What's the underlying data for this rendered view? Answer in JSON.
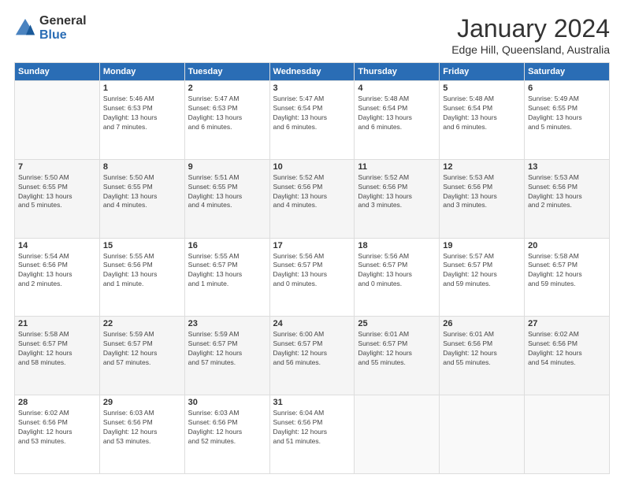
{
  "header": {
    "logo_general": "General",
    "logo_blue": "Blue",
    "month_title": "January 2024",
    "location": "Edge Hill, Queensland, Australia"
  },
  "weekdays": [
    "Sunday",
    "Monday",
    "Tuesday",
    "Wednesday",
    "Thursday",
    "Friday",
    "Saturday"
  ],
  "weeks": [
    [
      {
        "day": "",
        "info": ""
      },
      {
        "day": "1",
        "info": "Sunrise: 5:46 AM\nSunset: 6:53 PM\nDaylight: 13 hours\nand 7 minutes."
      },
      {
        "day": "2",
        "info": "Sunrise: 5:47 AM\nSunset: 6:53 PM\nDaylight: 13 hours\nand 6 minutes."
      },
      {
        "day": "3",
        "info": "Sunrise: 5:47 AM\nSunset: 6:54 PM\nDaylight: 13 hours\nand 6 minutes."
      },
      {
        "day": "4",
        "info": "Sunrise: 5:48 AM\nSunset: 6:54 PM\nDaylight: 13 hours\nand 6 minutes."
      },
      {
        "day": "5",
        "info": "Sunrise: 5:48 AM\nSunset: 6:54 PM\nDaylight: 13 hours\nand 6 minutes."
      },
      {
        "day": "6",
        "info": "Sunrise: 5:49 AM\nSunset: 6:55 PM\nDaylight: 13 hours\nand 5 minutes."
      }
    ],
    [
      {
        "day": "7",
        "info": "Sunrise: 5:50 AM\nSunset: 6:55 PM\nDaylight: 13 hours\nand 5 minutes."
      },
      {
        "day": "8",
        "info": "Sunrise: 5:50 AM\nSunset: 6:55 PM\nDaylight: 13 hours\nand 4 minutes."
      },
      {
        "day": "9",
        "info": "Sunrise: 5:51 AM\nSunset: 6:55 PM\nDaylight: 13 hours\nand 4 minutes."
      },
      {
        "day": "10",
        "info": "Sunrise: 5:52 AM\nSunset: 6:56 PM\nDaylight: 13 hours\nand 4 minutes."
      },
      {
        "day": "11",
        "info": "Sunrise: 5:52 AM\nSunset: 6:56 PM\nDaylight: 13 hours\nand 3 minutes."
      },
      {
        "day": "12",
        "info": "Sunrise: 5:53 AM\nSunset: 6:56 PM\nDaylight: 13 hours\nand 3 minutes."
      },
      {
        "day": "13",
        "info": "Sunrise: 5:53 AM\nSunset: 6:56 PM\nDaylight: 13 hours\nand 2 minutes."
      }
    ],
    [
      {
        "day": "14",
        "info": "Sunrise: 5:54 AM\nSunset: 6:56 PM\nDaylight: 13 hours\nand 2 minutes."
      },
      {
        "day": "15",
        "info": "Sunrise: 5:55 AM\nSunset: 6:56 PM\nDaylight: 13 hours\nand 1 minute."
      },
      {
        "day": "16",
        "info": "Sunrise: 5:55 AM\nSunset: 6:57 PM\nDaylight: 13 hours\nand 1 minute."
      },
      {
        "day": "17",
        "info": "Sunrise: 5:56 AM\nSunset: 6:57 PM\nDaylight: 13 hours\nand 0 minutes."
      },
      {
        "day": "18",
        "info": "Sunrise: 5:56 AM\nSunset: 6:57 PM\nDaylight: 13 hours\nand 0 minutes."
      },
      {
        "day": "19",
        "info": "Sunrise: 5:57 AM\nSunset: 6:57 PM\nDaylight: 12 hours\nand 59 minutes."
      },
      {
        "day": "20",
        "info": "Sunrise: 5:58 AM\nSunset: 6:57 PM\nDaylight: 12 hours\nand 59 minutes."
      }
    ],
    [
      {
        "day": "21",
        "info": "Sunrise: 5:58 AM\nSunset: 6:57 PM\nDaylight: 12 hours\nand 58 minutes."
      },
      {
        "day": "22",
        "info": "Sunrise: 5:59 AM\nSunset: 6:57 PM\nDaylight: 12 hours\nand 57 minutes."
      },
      {
        "day": "23",
        "info": "Sunrise: 5:59 AM\nSunset: 6:57 PM\nDaylight: 12 hours\nand 57 minutes."
      },
      {
        "day": "24",
        "info": "Sunrise: 6:00 AM\nSunset: 6:57 PM\nDaylight: 12 hours\nand 56 minutes."
      },
      {
        "day": "25",
        "info": "Sunrise: 6:01 AM\nSunset: 6:57 PM\nDaylight: 12 hours\nand 55 minutes."
      },
      {
        "day": "26",
        "info": "Sunrise: 6:01 AM\nSunset: 6:56 PM\nDaylight: 12 hours\nand 55 minutes."
      },
      {
        "day": "27",
        "info": "Sunrise: 6:02 AM\nSunset: 6:56 PM\nDaylight: 12 hours\nand 54 minutes."
      }
    ],
    [
      {
        "day": "28",
        "info": "Sunrise: 6:02 AM\nSunset: 6:56 PM\nDaylight: 12 hours\nand 53 minutes."
      },
      {
        "day": "29",
        "info": "Sunrise: 6:03 AM\nSunset: 6:56 PM\nDaylight: 12 hours\nand 53 minutes."
      },
      {
        "day": "30",
        "info": "Sunrise: 6:03 AM\nSunset: 6:56 PM\nDaylight: 12 hours\nand 52 minutes."
      },
      {
        "day": "31",
        "info": "Sunrise: 6:04 AM\nSunset: 6:56 PM\nDaylight: 12 hours\nand 51 minutes."
      },
      {
        "day": "",
        "info": ""
      },
      {
        "day": "",
        "info": ""
      },
      {
        "day": "",
        "info": ""
      }
    ]
  ]
}
